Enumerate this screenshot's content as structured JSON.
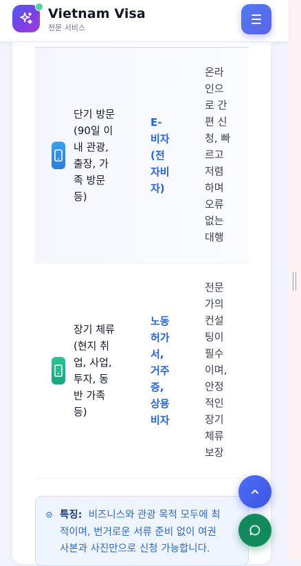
{
  "header": {
    "brand_title": "Vietnam Visa",
    "brand_subtitle": "전문 서비스",
    "logo_icon": "sparkles-icon",
    "menu_icon": "hamburger-menu-icon"
  },
  "visa_table": {
    "rows": [
      {
        "icon": "smartphone-icon",
        "icon_color": "#2f8fe8",
        "purpose": "단기 방문\n(90일 이\n내 관광,\n출장, 가\n족 방문\n등)",
        "visa_type": "E-\n비자\n(전\n자비\n자)",
        "description": "온라\n인으\n로 간\n편 신\n청, 빠\n르고\n저렴\n하며\n오류\n없는\n대행"
      },
      {
        "icon": "building-icon",
        "icon_color": "#1fb58a",
        "purpose": "장기 체류\n(현지 취\n업, 사업,\n투자, 동\n반 가족\n등)",
        "visa_type": "노동\n허가\n서,\n거주\n증,\n상용\n비자",
        "description": "전문\n가의\n컨설\n팅이\n필수\n이며,\n안정\n적인\n장기\n체류\n보장"
      }
    ]
  },
  "note": {
    "icon": "info-circle-icon",
    "label": "특징:",
    "text": "비즈니스와 관광 목적 모두에 최\n적이며, 번거로운 서류 준비 없이 여권\n사본과 사진만으로 신청 가능합니다."
  },
  "floating_buttons": {
    "scroll_top_icon": "chevron-up-icon",
    "chat_icon": "chat-bubble-icon"
  },
  "colors": {
    "accent": "#4e6ef2",
    "visa_link": "#2563d8",
    "chat_green": "#128a5c"
  }
}
